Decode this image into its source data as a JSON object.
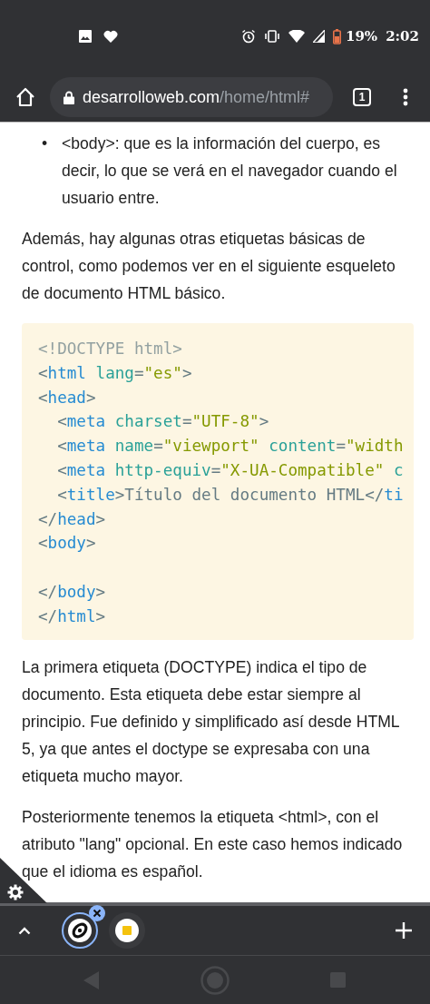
{
  "status_bar": {
    "battery": "19%",
    "time": "2:02"
  },
  "toolbar": {
    "url_domain": "desarrolloweb.com",
    "url_path": "/home/html#",
    "tab_count": "1"
  },
  "article": {
    "bullets": [
      {
        "marker": "•",
        "text": "<body>: que es la información del cuerpo, es decir, lo que se verá en el navegador cuando el usuario entre."
      }
    ],
    "intro": "Además, hay algunas otras etiquetas básicas de control, como podemos ver en el siguiente esqueleto de documento HTML básico.",
    "code": [
      {
        "kind": "code",
        "tokens": [
          {
            "kind": "comment",
            "text": "<!DOCTYPE html>"
          }
        ]
      },
      {
        "kind": "code",
        "tokens": [
          {
            "kind": "punct",
            "text": "<"
          },
          {
            "kind": "tag",
            "text": "html"
          },
          {
            "kind": "attr",
            "text": " lang"
          },
          {
            "kind": "punct",
            "text": "="
          },
          {
            "kind": "str",
            "text": "\"es\""
          },
          {
            "kind": "punct",
            "text": ">"
          }
        ]
      },
      {
        "kind": "code",
        "tokens": [
          {
            "kind": "punct",
            "text": "<"
          },
          {
            "kind": "tag",
            "text": "head"
          },
          {
            "kind": "punct",
            "text": ">"
          }
        ]
      },
      {
        "kind": "code",
        "tokens": [
          {
            "kind": "punct",
            "text": "  <"
          },
          {
            "kind": "tag",
            "text": "meta"
          },
          {
            "kind": "attr",
            "text": " charset"
          },
          {
            "kind": "punct",
            "text": "="
          },
          {
            "kind": "str",
            "text": "\"UTF-8\""
          },
          {
            "kind": "punct",
            "text": ">"
          }
        ]
      },
      {
        "kind": "code",
        "tokens": [
          {
            "kind": "punct",
            "text": "  <"
          },
          {
            "kind": "tag",
            "text": "meta"
          },
          {
            "kind": "attr",
            "text": " name"
          },
          {
            "kind": "punct",
            "text": "="
          },
          {
            "kind": "str",
            "text": "\"viewport\""
          },
          {
            "kind": "attr",
            "text": " content"
          },
          {
            "kind": "punct",
            "text": "="
          },
          {
            "kind": "str",
            "text": "\"width"
          }
        ]
      },
      {
        "kind": "code",
        "tokens": [
          {
            "kind": "punct",
            "text": "  <"
          },
          {
            "kind": "tag",
            "text": "meta"
          },
          {
            "kind": "attr",
            "text": " http-equiv"
          },
          {
            "kind": "punct",
            "text": "="
          },
          {
            "kind": "str",
            "text": "\"X-UA-Compatible\""
          },
          {
            "kind": "attr",
            "text": " c"
          }
        ]
      },
      {
        "kind": "code",
        "tokens": [
          {
            "kind": "punct",
            "text": "  <"
          },
          {
            "kind": "tag",
            "text": "title"
          },
          {
            "kind": "punct",
            "text": ">Título del documento HTML</"
          },
          {
            "kind": "tag",
            "text": "ti"
          }
        ]
      },
      {
        "kind": "code",
        "tokens": [
          {
            "kind": "punct",
            "text": "</"
          },
          {
            "kind": "tag",
            "text": "head"
          },
          {
            "kind": "punct",
            "text": ">"
          }
        ]
      },
      {
        "kind": "code",
        "tokens": [
          {
            "kind": "punct",
            "text": "<"
          },
          {
            "kind": "tag",
            "text": "body"
          },
          {
            "kind": "punct",
            "text": ">"
          }
        ]
      },
      {
        "kind": "blank"
      },
      {
        "kind": "code",
        "tokens": [
          {
            "kind": "punct",
            "text": "</"
          },
          {
            "kind": "tag",
            "text": "body"
          },
          {
            "kind": "punct",
            "text": ">"
          }
        ]
      },
      {
        "kind": "code",
        "tokens": [
          {
            "kind": "punct",
            "text": "</"
          },
          {
            "kind": "tag",
            "text": "html"
          },
          {
            "kind": "punct",
            "text": ">"
          }
        ]
      }
    ],
    "paragraphs": [
      "La primera etiqueta (DOCTYPE) indica el tipo de documento. Esta etiqueta debe estar siempre al principio. Fue definido y simplificado así desde HTML 5, ya que antes el doctype se expresaba con una etiqueta mucho mayor.",
      "Posteriormente tenemos la etiqueta <html>, con el atributo \"lang\" opcional. En este caso hemos indicado que el idioma es español."
    ]
  },
  "tabs": [
    {
      "kind": "site",
      "selected": true
    },
    {
      "kind": "doc",
      "selected": false
    }
  ]
}
